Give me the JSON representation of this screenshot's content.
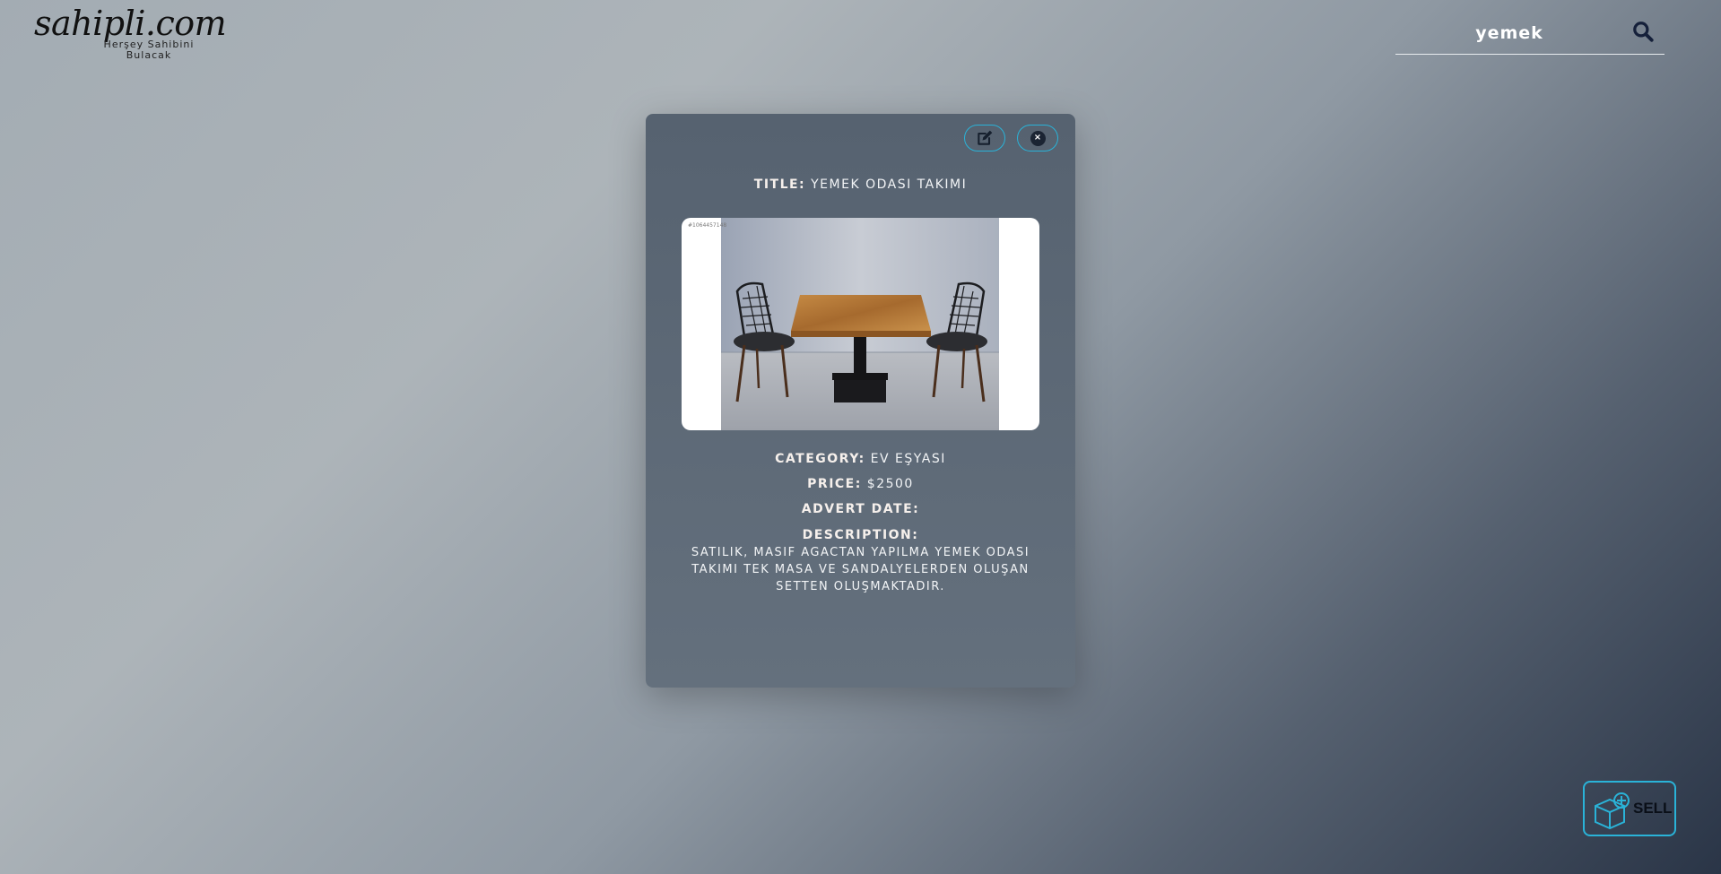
{
  "logo": {
    "name": "sahipli.com",
    "tagline_line1": "Herşey Sahibini",
    "tagline_line2": "Bulacak"
  },
  "search": {
    "value": "yemek",
    "icon": "search-icon"
  },
  "modal": {
    "edit_icon": "edit-icon",
    "close_icon": "close-icon",
    "close_glyph": "×",
    "title_label": "TITLE:",
    "title_value": "YEMEK ODASI TAKIMI",
    "image_watermark": "#1064457148",
    "category_label": "CATEGORY:",
    "category_value": "EV EŞYASI",
    "price_label": "PRICE:",
    "price_value": "$2500",
    "advert_date_label": "ADVERT DATE:",
    "advert_date_value": "",
    "description_label": "DESCRIPTION:",
    "description_value": "SATILIK, MASIF AGACTAN YAPILMA YEMEK ODASI TAKIMI TEK MASA VE SANDALYELERDEN OLUŞAN SETTEN OLUŞMAKTADIR."
  },
  "sell_button": {
    "label": "SELL",
    "icon": "box-plus-icon"
  },
  "colors": {
    "accent": "#2ab3d8",
    "modal_bg": "#5d6976",
    "search_icon": "#15203a"
  }
}
